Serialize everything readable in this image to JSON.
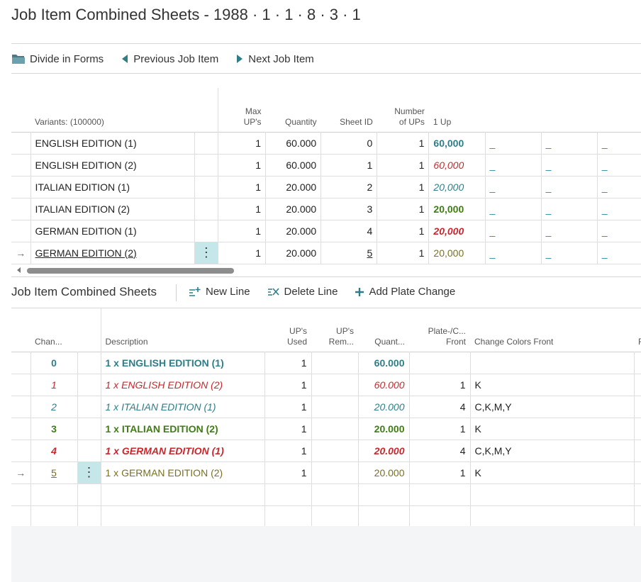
{
  "page": {
    "title": "Job Item Combined Sheets - 1988 · 1 · 1 · 8 · 3 · 1"
  },
  "toolbar": {
    "divide_label": "Divide in Forms",
    "prev_label": "Previous Job Item",
    "next_label": "Next Job Item"
  },
  "variants_grid": {
    "headers": {
      "variant": "Variants: (100000)",
      "max_ups": "Max\nUP's",
      "quantity": "Quantity",
      "sheet_id": "Sheet ID",
      "num_ups": "Number\nof UPs",
      "one_up": "1 Up"
    },
    "blank_marker": "_",
    "rows": [
      {
        "name": "ENGLISH EDITION (1)",
        "max_ups": "1",
        "quantity": "60.000",
        "sheet_id": "0",
        "num_ups": "1",
        "one_up": "60,000"
      },
      {
        "name": "ENGLISH EDITION (2)",
        "max_ups": "1",
        "quantity": "60.000",
        "sheet_id": "1",
        "num_ups": "1",
        "one_up": "60,000"
      },
      {
        "name": "ITALIAN EDITION (1)",
        "max_ups": "1",
        "quantity": "20.000",
        "sheet_id": "2",
        "num_ups": "1",
        "one_up": "20,000"
      },
      {
        "name": "ITALIAN EDITION (2)",
        "max_ups": "1",
        "quantity": "20.000",
        "sheet_id": "3",
        "num_ups": "1",
        "one_up": "20,000"
      },
      {
        "name": "GERMAN EDITION (1)",
        "max_ups": "1",
        "quantity": "20.000",
        "sheet_id": "4",
        "num_ups": "1",
        "one_up": "20,000"
      },
      {
        "name": "GERMAN EDITION (2)",
        "max_ups": "1",
        "quantity": "20.000",
        "sheet_id": "5",
        "num_ups": "1",
        "one_up": "20,000"
      }
    ],
    "row_arrow": "→",
    "row_menu": "⋮"
  },
  "sheets_section": {
    "title": "Job Item Combined Sheets",
    "new_line_label": "New Line",
    "delete_line_label": "Delete Line",
    "add_plate_label": "Add Plate Change"
  },
  "sheets_grid": {
    "headers": {
      "change": "Chan...",
      "description": "Description",
      "ups_used": "UP's\nUsed",
      "ups_rem": "UP's\nRem...",
      "quantity": "Quant...",
      "plate_front": "Plate-/C...\nFront",
      "change_colors": "Change Colors Front",
      "extra": "F"
    },
    "rows": [
      {
        "change": "0",
        "description": "1 x ENGLISH EDITION (1)",
        "ups_used": "1",
        "ups_rem": "",
        "quantity": "60.000",
        "plate_front": "",
        "colors": ""
      },
      {
        "change": "1",
        "description": "1 x ENGLISH EDITION (2)",
        "ups_used": "1",
        "ups_rem": "",
        "quantity": "60.000",
        "plate_front": "1",
        "colors": "K"
      },
      {
        "change": "2",
        "description": "1 x ITALIAN EDITION (1)",
        "ups_used": "1",
        "ups_rem": "",
        "quantity": "20.000",
        "plate_front": "4",
        "colors": "C,K,M,Y"
      },
      {
        "change": "3",
        "description": "1 x ITALIAN EDITION (2)",
        "ups_used": "1",
        "ups_rem": "",
        "quantity": "20.000",
        "plate_front": "1",
        "colors": "K"
      },
      {
        "change": "4",
        "description": "1 x GERMAN EDITION (1)",
        "ups_used": "1",
        "ups_rem": "",
        "quantity": "20.000",
        "plate_front": "4",
        "colors": "C,K,M,Y"
      },
      {
        "change": "5",
        "description": "1 x GERMAN EDITION (2)",
        "ups_used": "1",
        "ups_rem": "",
        "quantity": "20.000",
        "plate_front": "1",
        "colors": "K"
      }
    ]
  },
  "colors": {
    "teal": "#2e7d89",
    "red": "#c8282d",
    "green": "#3f7d14",
    "olive": "#7a7020",
    "selection": "#c6e7ea"
  }
}
